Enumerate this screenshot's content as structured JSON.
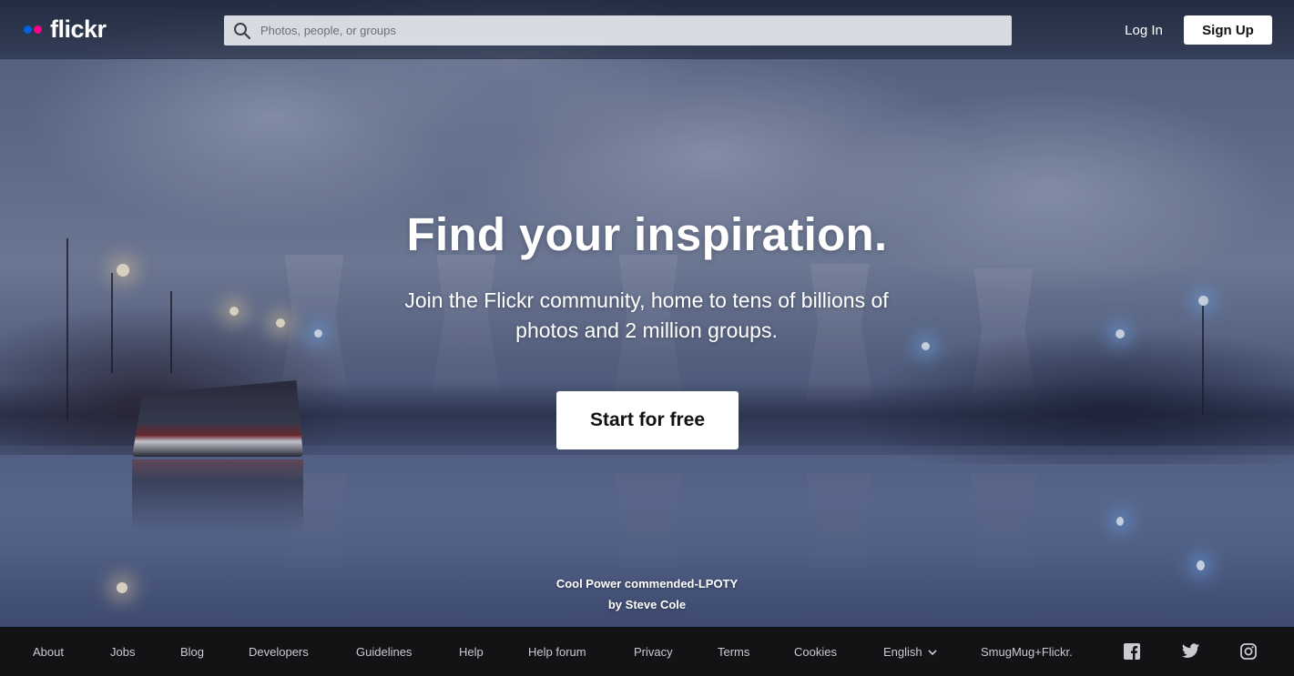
{
  "brand": {
    "name": "flickr",
    "blue": "#0063dc",
    "pink": "#ff0084"
  },
  "header": {
    "search": {
      "placeholder": "Photos, people, or groups",
      "icon": "search-icon"
    },
    "login_label": "Log In",
    "signup_label": "Sign Up"
  },
  "hero": {
    "headline": "Find your inspiration.",
    "subline_1": "Join the Flickr community, home to tens of billions of",
    "subline_2": "photos and 2 million groups.",
    "cta_label": "Start for free",
    "photo_title": "Cool Power commended-LPOTY",
    "photo_credit": "by Steve Cole"
  },
  "footer": {
    "links": [
      "About",
      "Jobs",
      "Blog",
      "Developers",
      "Guidelines",
      "Help",
      "Help forum",
      "Privacy",
      "Terms",
      "Cookies"
    ],
    "language": "English",
    "smugmug": "SmugMug+Flickr.",
    "social": [
      "facebook-icon",
      "twitter-icon",
      "instagram-icon"
    ]
  }
}
